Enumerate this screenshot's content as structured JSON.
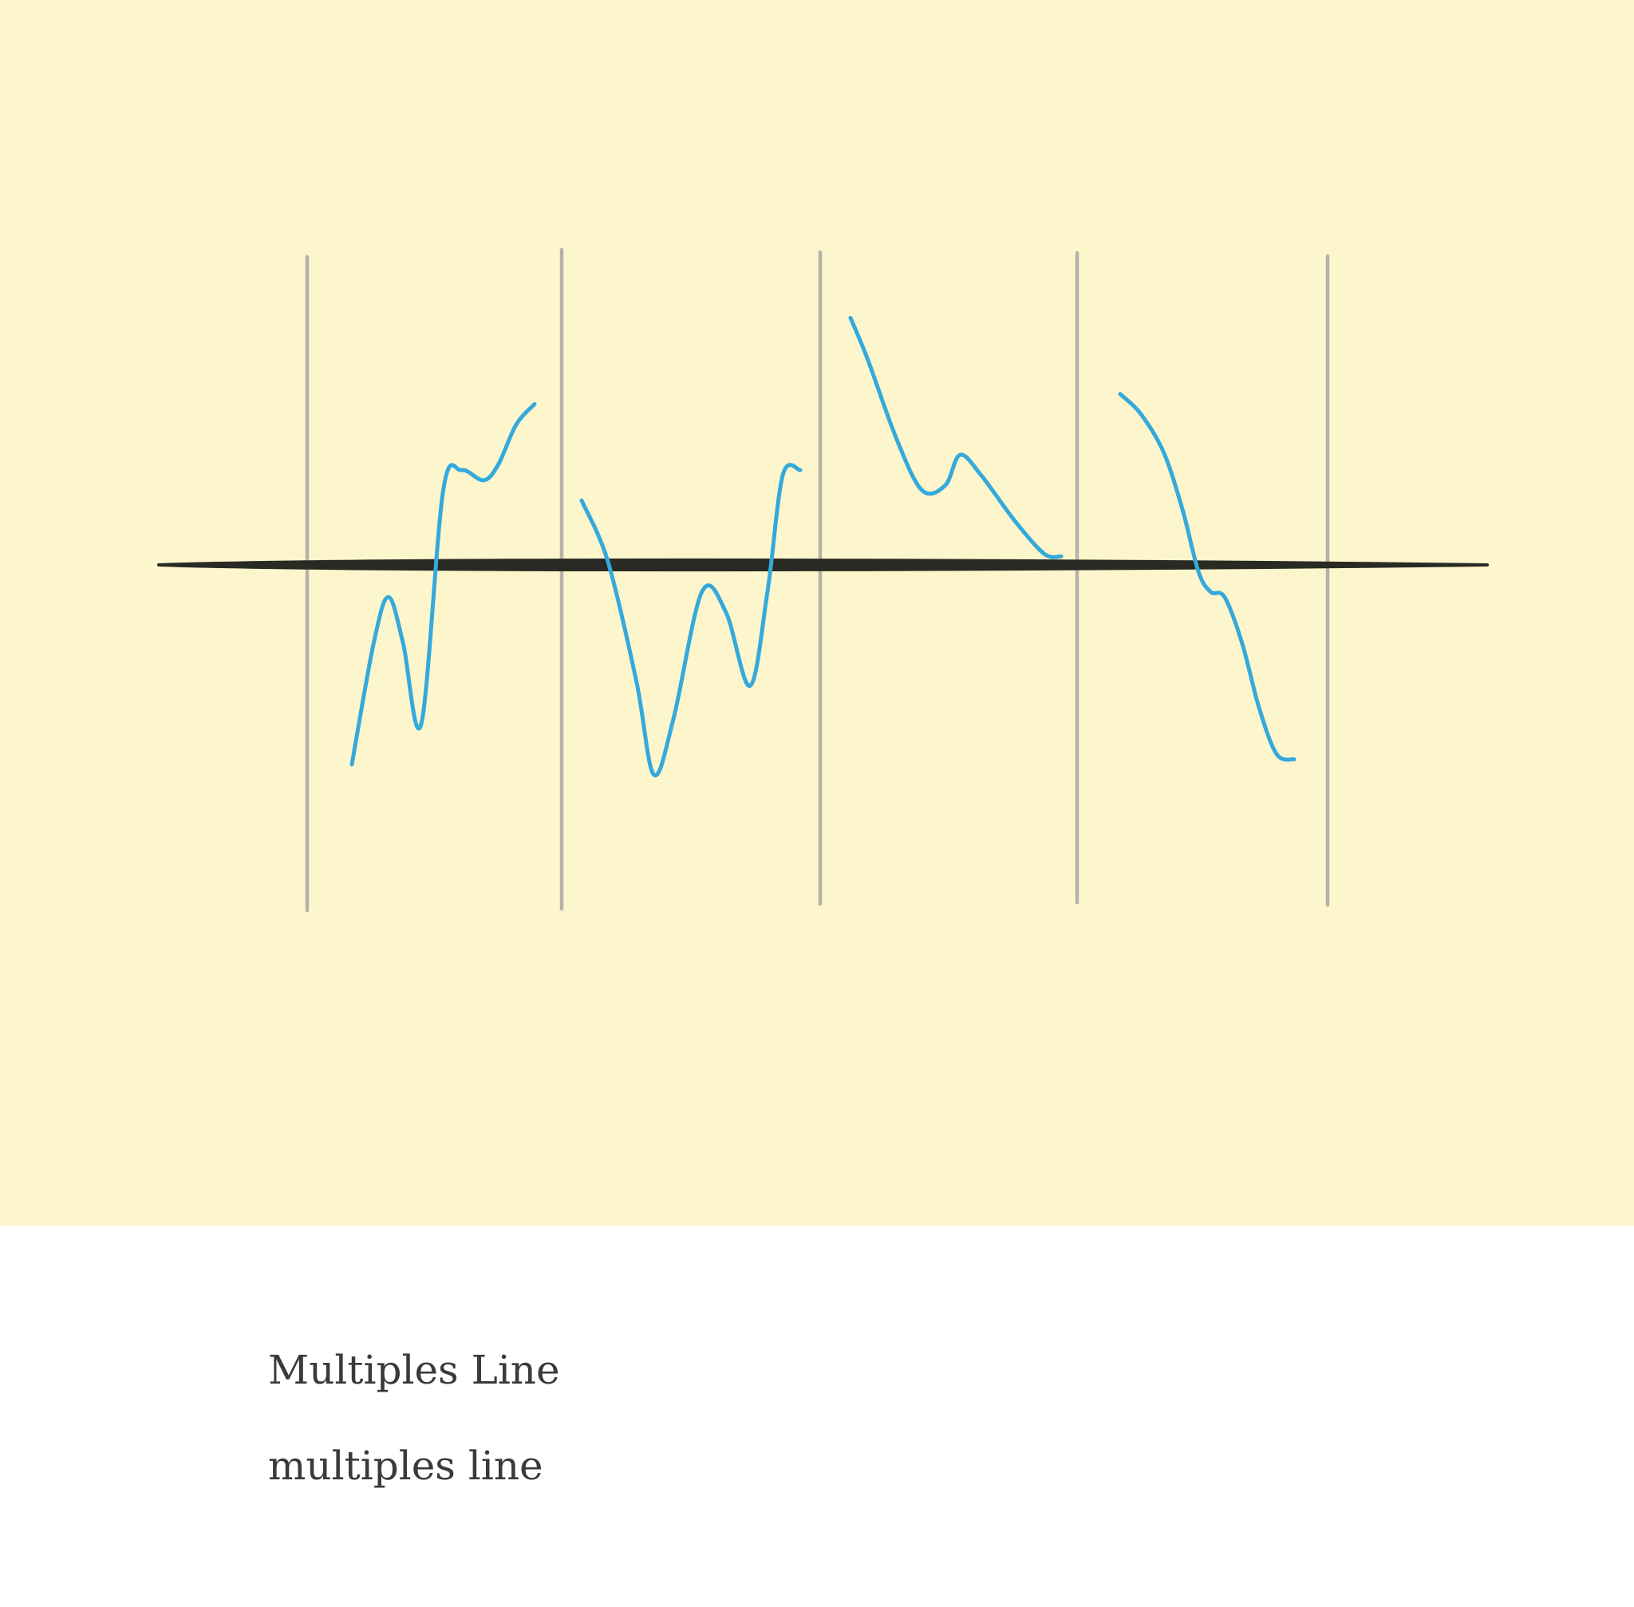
{
  "colors": {
    "background": "#fdf5cc",
    "page": "#ffffff",
    "axis": "#2a2a24",
    "divider": "#b5b3aa",
    "line": "#34aadc",
    "text": "#3a3a3a"
  },
  "captions": {
    "title": "Multiples Line",
    "subtitle": "multiples line"
  },
  "chart_data": {
    "type": "line",
    "title": "",
    "xlabel": "",
    "ylabel": "",
    "baseline_value": 0,
    "ylim": [
      -1,
      1
    ],
    "grid": false,
    "legend": false,
    "panels": [
      {
        "name": "",
        "x": [
          0,
          0.12,
          0.2,
          0.28,
          0.38,
          0.5,
          0.6,
          0.72,
          0.8,
          0.9,
          1
        ],
        "values": [
          -0.78,
          -0.3,
          -0.12,
          -0.3,
          -0.62,
          0.3,
          0.38,
          0.34,
          0.4,
          0.56,
          0.64
        ]
      },
      {
        "name": "",
        "x": [
          0,
          0.12,
          0.25,
          0.33,
          0.42,
          0.55,
          0.66,
          0.77,
          0.85,
          0.92,
          1
        ],
        "values": [
          0.26,
          0.02,
          -0.45,
          -0.82,
          -0.6,
          -0.1,
          -0.18,
          -0.47,
          -0.1,
          0.36,
          0.38
        ]
      },
      {
        "name": "",
        "x": [
          0,
          0.08,
          0.22,
          0.34,
          0.45,
          0.52,
          0.62,
          0.78,
          0.92,
          1
        ],
        "values": [
          0.98,
          0.82,
          0.5,
          0.3,
          0.32,
          0.44,
          0.36,
          0.18,
          0.05,
          0.04
        ]
      },
      {
        "name": "",
        "x": [
          0,
          0.12,
          0.25,
          0.36,
          0.45,
          0.52,
          0.6,
          0.7,
          0.8,
          0.9,
          1
        ],
        "values": [
          0.68,
          0.6,
          0.45,
          0.22,
          -0.02,
          -0.1,
          -0.12,
          -0.3,
          -0.56,
          -0.74,
          -0.76
        ]
      }
    ]
  }
}
